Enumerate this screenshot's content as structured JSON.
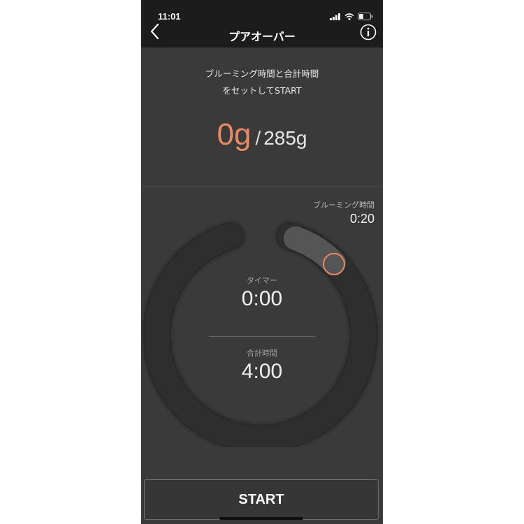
{
  "status_bar": {
    "time": "11:01"
  },
  "header": {
    "title": "プアオーバー",
    "back_icon": "chevron-left-icon",
    "info_icon": "info-icon"
  },
  "instruction": {
    "line1": "ブルーミング時間と合計時間",
    "line2": "をセットしてSTART"
  },
  "weight": {
    "current": "0g",
    "separator": "/",
    "target": "285g"
  },
  "blooming": {
    "label": "ブルーミング時間",
    "value": "0:20"
  },
  "timer": {
    "label": "タイマー",
    "value": "0:00"
  },
  "total": {
    "label": "合計時間",
    "value": "4:00"
  },
  "start_button": {
    "label": "START"
  },
  "colors": {
    "accent": "#e88a60",
    "background": "#3a3a3a",
    "bar": "#1c1c1c"
  }
}
